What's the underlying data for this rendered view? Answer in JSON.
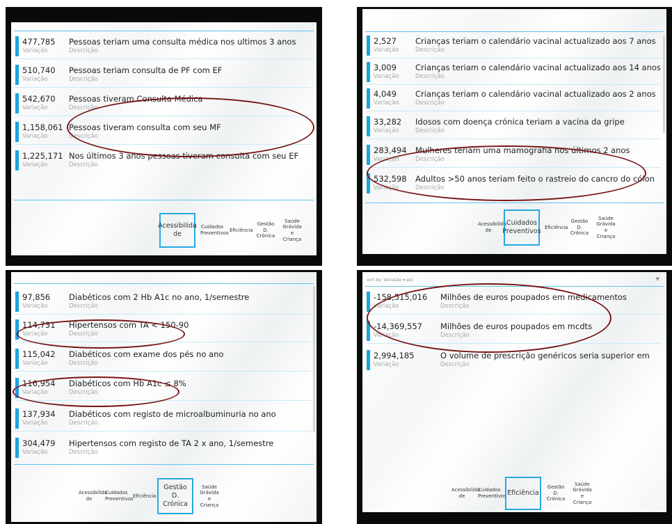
{
  "labels": {
    "variation": "Variação",
    "description": "Descrição"
  },
  "colors": {
    "accent": "#19a3e0",
    "annotation": "#7a1414"
  },
  "panels": [
    {
      "rows": [
        {
          "value": "477,785",
          "description": "Pessoas teriam uma consulta médica nos ultimos 3 anos"
        },
        {
          "value": "510,740",
          "description": "Pessoas teriam consulta de PF com  EF"
        },
        {
          "value": "542,670",
          "description": "Pessoas tiveram Consulta Médica"
        },
        {
          "value": "1,158,061",
          "description": "Pessoas tiveram consulta com seu MF"
        },
        {
          "value": "1,225,171",
          "description": "Nos últimos 3 anos pessoas tiveram consulta com seu EF"
        }
      ],
      "tabs": [
        "Acessibilida de",
        "Cuidados Preventivos",
        "Eficiência",
        "Gestão D. Crónica",
        "Saúde Grávida e Criança"
      ],
      "active_tab": "Acessibilida de"
    },
    {
      "rows": [
        {
          "value": "2,527",
          "description": "Crianças teriam o calendário vacinal actualizado aos 7 anos"
        },
        {
          "value": "3,009",
          "description": "Crianças teriam o calendário vacinal actualizado aos 14 anos"
        },
        {
          "value": "4,049",
          "description": "Crianças teriam o calendário vacinal actualizado aos 2 anos"
        },
        {
          "value": "33,282",
          "description": "Idosos com doença crónica teriam a vacina da gripe"
        },
        {
          "value": "283,494",
          "description": "Mulheres teriam uma mamografia nos últimos 2 anos"
        },
        {
          "value": "532,598",
          "description": "Adultos >50 anos teriam feito o rastreio do cancro do cólon"
        }
      ],
      "tabs": [
        "Acessibilida de",
        "Cuidados Preventivos",
        "Eficiência",
        "Gestão D. Crónica",
        "Saúde Grávida e Criança"
      ],
      "active_tab": "Cuidados Preventivos"
    },
    {
      "rows": [
        {
          "value": "97,856",
          "description": "Diabéticos com 2 Hb A1c no ano, 1/semestre"
        },
        {
          "value": "114,731",
          "description": "Hipertensos com TA < 150-90"
        },
        {
          "value": "115,042",
          "description": "Diabéticos com exame dos pés no ano"
        },
        {
          "value": "116,954",
          "description": "Diabéticos com Hb A1c ≤ 8%"
        },
        {
          "value": "137,934",
          "description": "Diabéticos com registo de microalbuminuria no ano"
        },
        {
          "value": "304,479",
          "description": "Hipertensos com registo de TA 2 x ano, 1/semestre"
        }
      ],
      "tabs": [
        "Acessibilida de",
        "Cuidados Preventivos",
        "Eficiência",
        "Gestão D. Crónica",
        "Saúde Grávida e Criança"
      ],
      "active_tab": "Gestão D. Crónica"
    },
    {
      "sort_text": "sort by: Variação ▾ asc",
      "rows": [
        {
          "value": "-158,515,016",
          "description": "Milhões de euros poupados em medicamentos"
        },
        {
          "value": "-14,369,557",
          "description": "Milhões de euros poupados em mcdts"
        },
        {
          "value": "2,994,185",
          "description": "O volume de prescrição genéricos seria superior em"
        }
      ],
      "tabs": [
        "Acessibilida de",
        "Cuidados Preventivos",
        "Eficiência",
        "Gestão D. Crónica",
        "Saúde Grávida e Criança"
      ],
      "active_tab": "Eficiência"
    }
  ]
}
